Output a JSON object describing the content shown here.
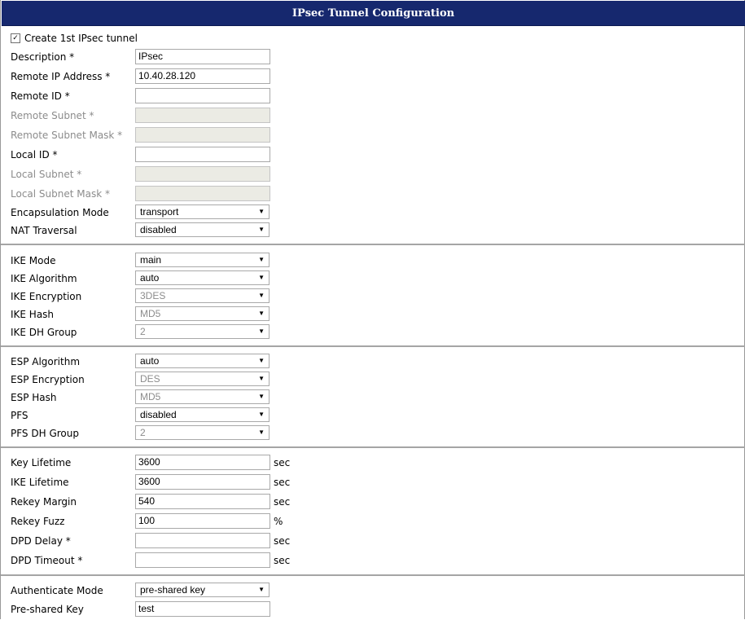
{
  "title": "IPsec Tunnel Configuration",
  "create_checkbox": {
    "label": "Create 1st IPsec tunnel",
    "checked": true,
    "mark": "✓"
  },
  "dropdown_arrow": "▼",
  "fields": {
    "description": {
      "label": "Description *",
      "value": "IPsec"
    },
    "remote_ip": {
      "label": "Remote IP Address *",
      "value": "10.40.28.120"
    },
    "remote_id": {
      "label": "Remote ID *",
      "value": ""
    },
    "remote_subnet": {
      "label": "Remote Subnet *",
      "value": ""
    },
    "remote_subnet_mask": {
      "label": "Remote Subnet Mask *",
      "value": ""
    },
    "local_id": {
      "label": "Local ID *",
      "value": ""
    },
    "local_subnet": {
      "label": "Local Subnet *",
      "value": ""
    },
    "local_subnet_mask": {
      "label": "Local Subnet Mask *",
      "value": ""
    },
    "encapsulation_mode": {
      "label": "Encapsulation Mode",
      "value": "transport"
    },
    "nat_traversal": {
      "label": "NAT Traversal",
      "value": "disabled"
    },
    "ike_mode": {
      "label": "IKE Mode",
      "value": "main"
    },
    "ike_algorithm": {
      "label": "IKE Algorithm",
      "value": "auto"
    },
    "ike_encryption": {
      "label": "IKE Encryption",
      "value": "3DES"
    },
    "ike_hash": {
      "label": "IKE Hash",
      "value": "MD5"
    },
    "ike_dh_group": {
      "label": "IKE DH Group",
      "value": "2"
    },
    "esp_algorithm": {
      "label": "ESP Algorithm",
      "value": "auto"
    },
    "esp_encryption": {
      "label": "ESP Encryption",
      "value": "DES"
    },
    "esp_hash": {
      "label": "ESP Hash",
      "value": "MD5"
    },
    "pfs": {
      "label": "PFS",
      "value": "disabled"
    },
    "pfs_dh_group": {
      "label": "PFS DH Group",
      "value": "2"
    },
    "key_lifetime": {
      "label": "Key Lifetime",
      "value": "3600",
      "unit": "sec"
    },
    "ike_lifetime": {
      "label": "IKE Lifetime",
      "value": "3600",
      "unit": "sec"
    },
    "rekey_margin": {
      "label": "Rekey Margin",
      "value": "540",
      "unit": "sec"
    },
    "rekey_fuzz": {
      "label": "Rekey Fuzz",
      "value": "100",
      "unit": "%"
    },
    "dpd_delay": {
      "label": "DPD Delay *",
      "value": "",
      "unit": "sec"
    },
    "dpd_timeout": {
      "label": "DPD Timeout *",
      "value": "",
      "unit": "sec"
    },
    "authenticate_mode": {
      "label": "Authenticate Mode",
      "value": "pre-shared key"
    },
    "pre_shared_key": {
      "label": "Pre-shared Key",
      "value": "test"
    }
  },
  "colors": {
    "header_bg": "#16286e",
    "disabled_text": "#8c8c8c",
    "disabled_input_bg": "#ebebe4"
  }
}
